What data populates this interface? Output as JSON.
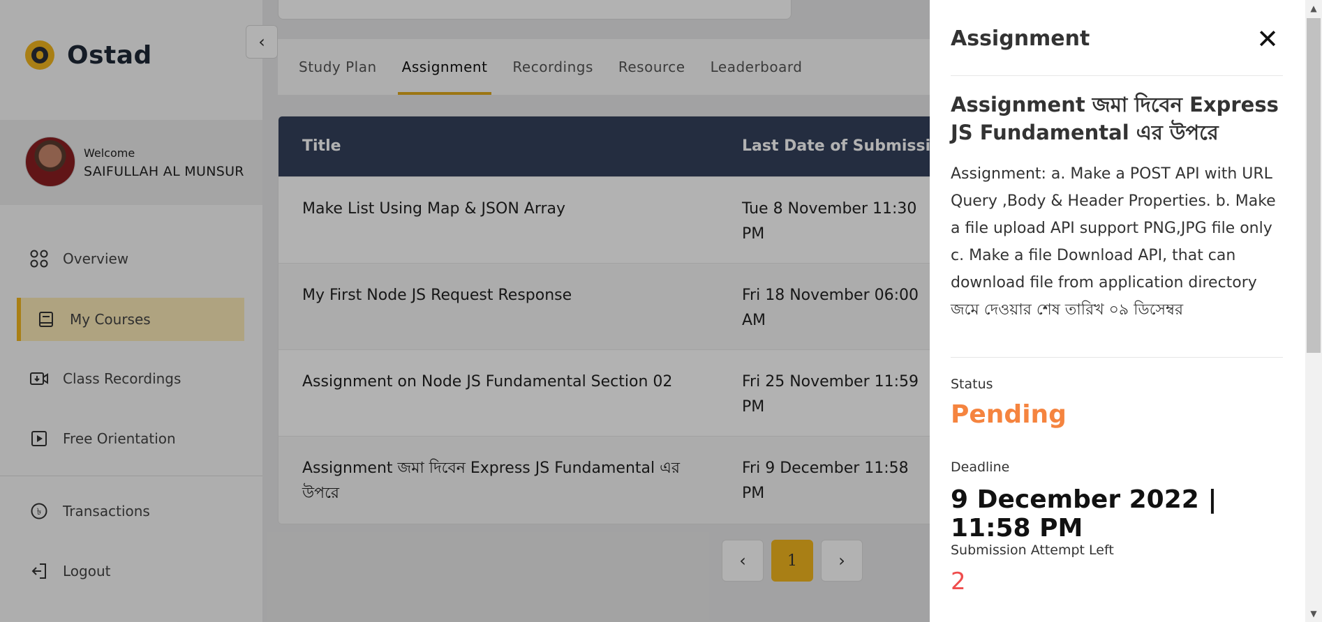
{
  "brand": {
    "name": "Ostad",
    "accent": "#f2b71f"
  },
  "user": {
    "welcome": "Welcome",
    "name": "SAIFULLAH AL MUNSUR"
  },
  "sidebar": {
    "items": [
      {
        "label": "Overview",
        "icon": "grid-icon"
      },
      {
        "label": "My Courses",
        "icon": "book-icon",
        "active": true
      },
      {
        "label": "Class Recordings",
        "icon": "video-icon"
      },
      {
        "label": "Free Orientation",
        "icon": "play-icon"
      },
      {
        "label": "Transactions",
        "icon": "taka-icon"
      },
      {
        "label": "Logout",
        "icon": "logout-icon"
      }
    ]
  },
  "tabs": [
    "Study Plan",
    "Assignment",
    "Recordings",
    "Resource",
    "Leaderboard"
  ],
  "active_tab": "Assignment",
  "table": {
    "headers": {
      "title": "Title",
      "date": "Last Date of Submission"
    },
    "rows": [
      {
        "title": "Make List Using Map & JSON Array",
        "date": "Tue 8 November 11:30 PM"
      },
      {
        "title": "My First Node JS Request Response",
        "date": "Fri 18 November 06:00 AM"
      },
      {
        "title": "Assignment on Node JS Fundamental Section 02",
        "date": "Fri 25 November 11:59 PM"
      },
      {
        "title": "Assignment জমা দিবেন Express JS Fundamental এর উপরে",
        "date": "Fri 9 December 11:58 PM"
      }
    ]
  },
  "pagination": {
    "current": "1",
    "prev": "‹",
    "next": "›"
  },
  "drawer": {
    "title": "Assignment",
    "close": "✕",
    "heading": "Assignment জমা দিবেন Express JS Fundamental এর উপরে",
    "description": "Assignment: a. Make a POST API with URL Query ,Body & Header Properties. b. Make a file upload API support PNG,JPG file only c. Make a file Download API, that can download file from application directory জমে দেওয়ার শেষ তারিখ ০৯ ডিসেম্বর",
    "status_label": "Status",
    "status": "Pending",
    "status_color": "#f5843f",
    "deadline_label": "Deadline",
    "deadline": "9 December 2022 | 11:58 PM",
    "attempts_label": "Submission Attempt Left",
    "attempts": "2",
    "attempts_color": "#ef4d4d"
  }
}
